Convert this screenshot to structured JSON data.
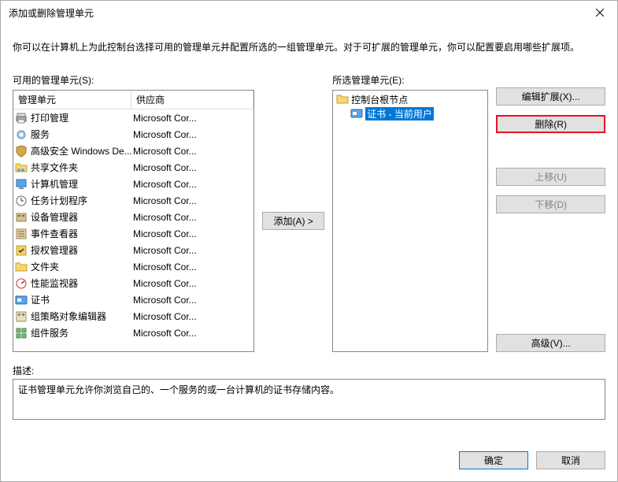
{
  "titlebar": {
    "title": "添加或删除管理单元"
  },
  "intro": "你可以在计算机上为此控制台选择可用的管理单元并配置所选的一组管理单元。对于可扩展的管理单元，你可以配置要启用哪些扩展项。",
  "available": {
    "label": "可用的管理单元(S):",
    "col_name": "管理单元",
    "col_vendor": "供应商",
    "items": [
      {
        "name": "打印管理",
        "vendor": "Microsoft Cor...",
        "icon": "printer-icon"
      },
      {
        "name": "服务",
        "vendor": "Microsoft Cor...",
        "icon": "gear-icon"
      },
      {
        "name": "高级安全 Windows De...",
        "vendor": "Microsoft Cor...",
        "icon": "shield-icon"
      },
      {
        "name": "共享文件夹",
        "vendor": "Microsoft Cor...",
        "icon": "shared-folder-icon"
      },
      {
        "name": "计算机管理",
        "vendor": "Microsoft Cor...",
        "icon": "computer-icon"
      },
      {
        "name": "任务计划程序",
        "vendor": "Microsoft Cor...",
        "icon": "clock-icon"
      },
      {
        "name": "设备管理器",
        "vendor": "Microsoft Cor...",
        "icon": "device-icon"
      },
      {
        "name": "事件查看器",
        "vendor": "Microsoft Cor...",
        "icon": "event-icon"
      },
      {
        "name": "授权管理器",
        "vendor": "Microsoft Cor...",
        "icon": "auth-icon"
      },
      {
        "name": "文件夹",
        "vendor": "Microsoft Cor...",
        "icon": "folder-icon"
      },
      {
        "name": "性能监视器",
        "vendor": "Microsoft Cor...",
        "icon": "perf-icon"
      },
      {
        "name": "证书",
        "vendor": "Microsoft Cor...",
        "icon": "cert-icon"
      },
      {
        "name": "组策略对象编辑器",
        "vendor": "Microsoft Cor...",
        "icon": "gpo-icon"
      },
      {
        "name": "组件服务",
        "vendor": "Microsoft Cor...",
        "icon": "component-icon"
      }
    ]
  },
  "middle": {
    "add_label": "添加(A) >"
  },
  "selected": {
    "label": "所选管理单元(E):",
    "root": "控制台根节点",
    "child": "证书 - 当前用户"
  },
  "buttons": {
    "edit_ext": "编辑扩展(X)...",
    "remove": "删除(R)",
    "move_up": "上移(U)",
    "move_down": "下移(D)",
    "advanced": "高级(V)..."
  },
  "desc": {
    "label": "描述:",
    "text": "证书管理单元允许你浏览自己的、一个服务的或一台计算机的证书存储内容。"
  },
  "footer": {
    "ok": "确定",
    "cancel": "取消"
  }
}
